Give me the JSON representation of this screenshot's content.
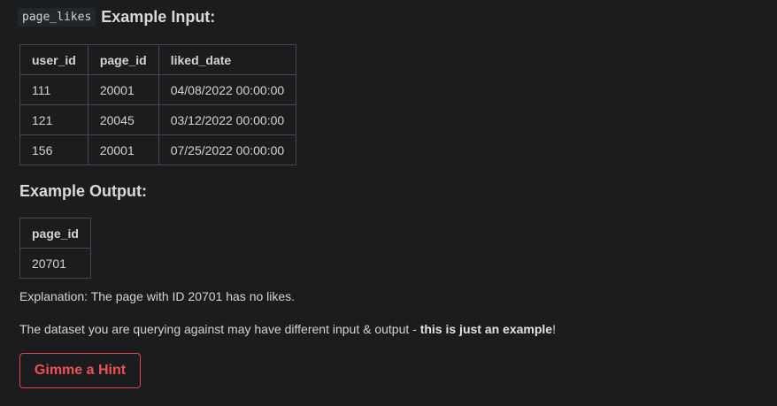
{
  "input_section": {
    "code_label": "page_likes",
    "heading_text": "Example Input:",
    "table": {
      "headers": [
        "user_id",
        "page_id",
        "liked_date"
      ],
      "rows": [
        [
          "111",
          "20001",
          "04/08/2022 00:00:00"
        ],
        [
          "121",
          "20045",
          "03/12/2022 00:00:00"
        ],
        [
          "156",
          "20001",
          "07/25/2022 00:00:00"
        ]
      ]
    }
  },
  "output_section": {
    "heading": "Example Output:",
    "table": {
      "headers": [
        "page_id"
      ],
      "rows": [
        [
          "20701"
        ]
      ]
    }
  },
  "explanation": "Explanation: The page with ID 20701 has no likes.",
  "disclaimer": {
    "prefix": "The dataset you are querying against may have different input & output - ",
    "bold": "this is just an example",
    "suffix": "!"
  },
  "hint_button": {
    "label": "Gimme a Hint"
  },
  "colors": {
    "background": "#1b1c1e",
    "text": "#d4d4d4",
    "table_border": "#45484c",
    "accent_red": "#ef5057"
  }
}
